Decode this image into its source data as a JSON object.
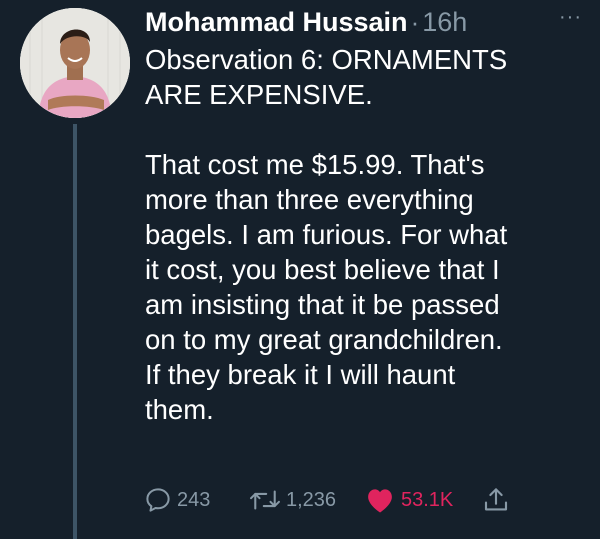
{
  "tweet": {
    "author_name": "Mohammad Hussain",
    "separator": "·",
    "timestamp": "16h",
    "more_icon": "···",
    "lines": [
      "Observation 6: ORNAMENTS",
      "ARE EXPENSIVE.",
      "",
      "That cost me $15.99. That's",
      "more than three everything",
      "bagels. I am furious. For what",
      "it cost, you best believe that I",
      "am insisting that it be passed",
      "on to my great grandchildren.",
      "If they break it I will haunt",
      "them."
    ]
  },
  "actions": {
    "reply": {
      "icon": "reply-icon",
      "count": "243"
    },
    "retweet": {
      "icon": "retweet-icon",
      "count": "1,236"
    },
    "like": {
      "icon": "heart-icon",
      "count": "53.1K"
    },
    "share": {
      "icon": "share-icon"
    }
  },
  "colors": {
    "background": "#15202b",
    "muted": "#8899a6",
    "like": "#e0245e",
    "thread_line": "#3d5466"
  }
}
